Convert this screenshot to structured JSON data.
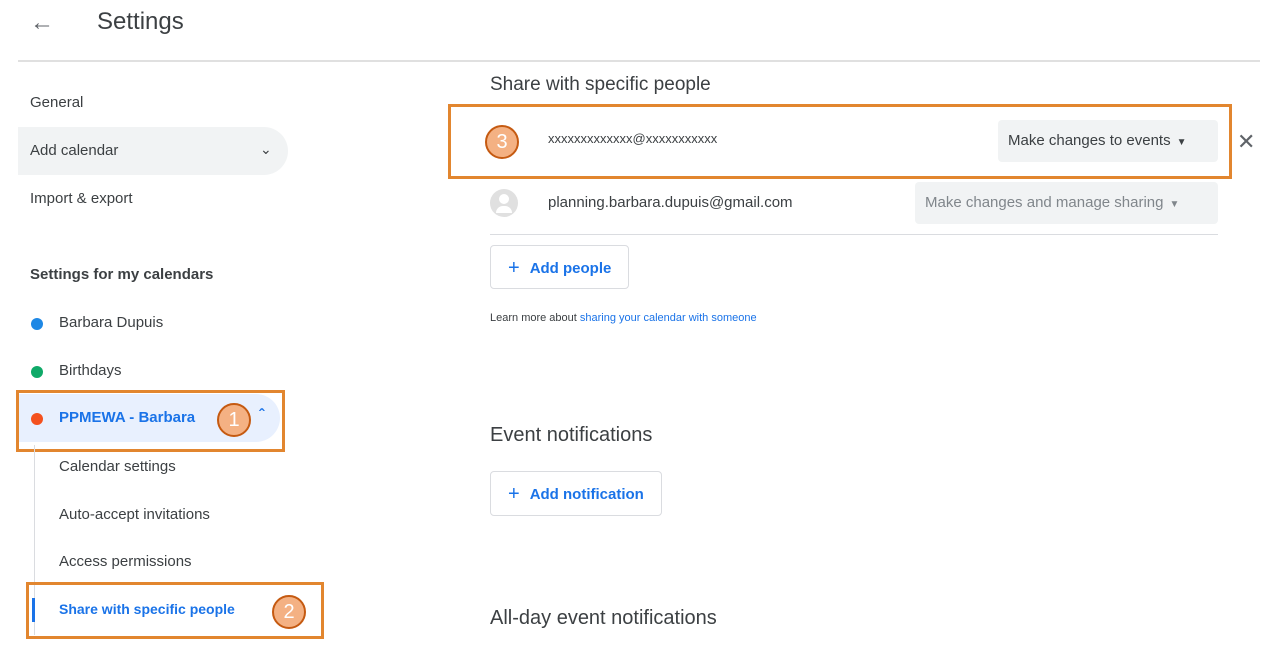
{
  "header": {
    "title": "Settings",
    "back_icon": "arrow-left-icon"
  },
  "sidebar": {
    "general": "General",
    "add_calendar": "Add calendar",
    "import_export": "Import & export",
    "my_calendars_heading": "Settings for my calendars",
    "calendars": [
      {
        "name": "Barbara Dupuis",
        "color": "#1e88e5"
      },
      {
        "name": "Birthdays",
        "color": "#0fa968"
      },
      {
        "name": "PPMEWA - Barbara",
        "color": "#f4511e"
      }
    ],
    "sub_items": [
      "Calendar settings",
      "Auto-accept invitations",
      "Access permissions",
      "Share with specific people"
    ]
  },
  "annotations": [
    "1",
    "2",
    "3"
  ],
  "main": {
    "share_section_title": "Share with specific people",
    "share_rows": [
      {
        "email": "xxxxxxxxxxxxx@xxxxxxxxxxx",
        "permission": "Make changes to events",
        "removable": true
      },
      {
        "email": "planning.barbara.dupuis@gmail.com",
        "permission": "Make changes and manage sharing",
        "removable": false
      }
    ],
    "add_people_label": "Add people",
    "learn_more_prefix": "Learn more about ",
    "learn_more_link": "sharing your calendar with someone",
    "event_notifications_title": "Event notifications",
    "add_notification_label": "Add notification",
    "all_day_notifications_title": "All-day event notifications"
  },
  "colors": {
    "accent": "#1a73e8",
    "annotation": "#e2862f"
  }
}
